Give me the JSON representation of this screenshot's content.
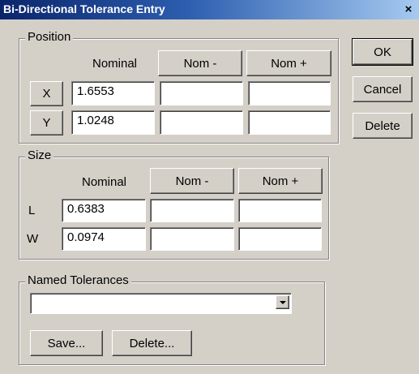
{
  "window": {
    "title": "Bi-Directional Tolerance Entry",
    "close_glyph": "×"
  },
  "position": {
    "group_label": "Position",
    "headers": {
      "nominal": "Nominal",
      "nom_minus": "Nom -",
      "nom_plus": "Nom +"
    },
    "rows": [
      {
        "label": "X",
        "nominal": "1.6553",
        "nom_minus": "",
        "nom_plus": ""
      },
      {
        "label": "Y",
        "nominal": "1.0248",
        "nom_minus": "",
        "nom_plus": ""
      }
    ]
  },
  "size": {
    "group_label": "Size",
    "headers": {
      "nominal": "Nominal",
      "nom_minus": "Nom -",
      "nom_plus": "Nom +"
    },
    "rows": [
      {
        "label": "L",
        "nominal": "0.6383",
        "nom_minus": "",
        "nom_plus": ""
      },
      {
        "label": "W",
        "nominal": "0.0974",
        "nom_minus": "",
        "nom_plus": ""
      }
    ]
  },
  "named_tolerances": {
    "group_label": "Named Tolerances",
    "selected": "",
    "save_label": "Save...",
    "delete_label": "Delete..."
  },
  "actions": {
    "ok_label": "OK",
    "cancel_label": "Cancel",
    "delete_label": "Delete"
  },
  "icons": {
    "dropdown": "chevron-down-icon",
    "close": "close-icon"
  }
}
